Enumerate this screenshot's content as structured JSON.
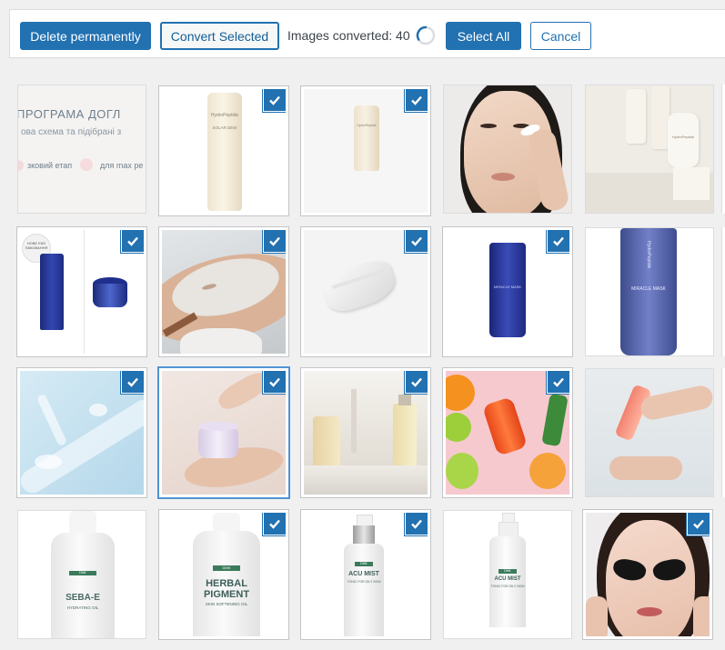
{
  "toolbar": {
    "delete_label": "Delete permanently",
    "convert_label": "Convert Selected",
    "status_text": "Images converted: 40",
    "select_all_label": "Select All",
    "cancel_label": "Cancel"
  },
  "colors": {
    "accent": "#2271b1",
    "background": "#f0f0f1"
  },
  "tiles": [
    {
      "subject": "promo banner with Ukrainian text",
      "selected": false,
      "text_line1": "ПРОГРАМА ДОГЛ",
      "text_line2": "ова схема та підібрані з",
      "text_line3a": "зковий етап",
      "text_line3b": "для max ре"
    },
    {
      "subject": "cream tube bottle",
      "selected": true,
      "brand": "HydroPeptide",
      "product_label": "SOLAR DEW"
    },
    {
      "subject": "small cream tube",
      "selected": true,
      "brand": "HydroPeptide"
    },
    {
      "subject": "woman applying face cream",
      "selected": false
    },
    {
      "subject": "three white product bottles",
      "selected": false,
      "brand": "HydroPeptide"
    },
    {
      "subject": "blue tube and jar set",
      "selected": true,
      "badge_text": "НОВЕ ЕКО ПАКОВАННЯ"
    },
    {
      "subject": "facial clay mask treatment",
      "selected": true
    },
    {
      "subject": "white cream smear",
      "selected": true
    },
    {
      "subject": "blue miracle mask tube",
      "selected": true,
      "product_label": "MIRACLE MASK"
    },
    {
      "subject": "large blue miracle mask tube",
      "selected": false,
      "brand": "HydroPeptide",
      "product_label": "MIRACLE MASK"
    },
    {
      "subject": "clear gel swatches",
      "selected": true
    },
    {
      "subject": "hands holding cream jar",
      "selected": true,
      "focused": true
    },
    {
      "subject": "serum bottles with dropper",
      "selected": true
    },
    {
      "subject": "orange serum and citrus",
      "selected": true
    },
    {
      "subject": "hands with pink tube",
      "selected": false
    },
    {
      "subject": "SEBA-E dropper bottle",
      "selected": false,
      "brand": "DMK",
      "product_name": "SEBA-E",
      "product_sub": "HYDRATING OIL"
    },
    {
      "subject": "Herbal Pigment bottle",
      "selected": true,
      "brand": "DMK",
      "product_name": "HERBAL",
      "product_name2": "PIGMENT",
      "product_sub": "SKIN SOFTENING OIL"
    },
    {
      "subject": "Acu Mist spray bottle",
      "selected": true,
      "brand": "DMK",
      "product_name": "ACU MIST",
      "product_sub": "TONIC FOR OILY SKIN"
    },
    {
      "subject": "Acu Mist small spray",
      "selected": false,
      "brand": "DMK",
      "product_name": "ACU MIST",
      "product_sub": "TONIC FOR OILY SKIN"
    },
    {
      "subject": "woman with black eye patches",
      "selected": true
    }
  ]
}
